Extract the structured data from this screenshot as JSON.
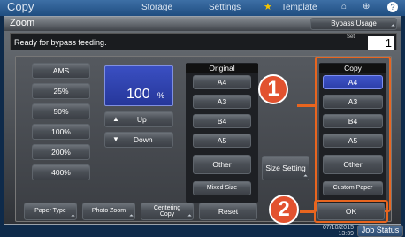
{
  "topbar": {
    "copy": "Copy",
    "storage": "Storage",
    "settings": "Settings",
    "template": "Template",
    "date": "07/10/2015",
    "time": "13:39",
    "job_status": "Job Status"
  },
  "dialog": {
    "title": "Zoom",
    "bypass_usage": "Bypass Usage",
    "status_message": "Ready for bypass feeding.",
    "set_label": "Set",
    "set_value": "1"
  },
  "zoom": {
    "presets": [
      "AMS",
      "25%",
      "50%",
      "100%",
      "200%",
      "400%"
    ],
    "value": "100",
    "unit": "%",
    "up_label": "Up",
    "down_label": "Down"
  },
  "original": {
    "header": "Original",
    "sizes": [
      "A4",
      "A3",
      "B4",
      "A5",
      "Other"
    ],
    "mixed_size": "Mixed Size",
    "size_setting": "Size Setting"
  },
  "copy_paper": {
    "header": "Copy",
    "sizes": [
      "A4",
      "A3",
      "B4",
      "A5",
      "Other"
    ],
    "custom_paper": "Custom Paper"
  },
  "bottom": {
    "paper_type": "Paper Type",
    "photo_zoom": "Photo Zoom",
    "centering_copy": "Centering Copy",
    "reset": "Reset",
    "ok": "OK"
  },
  "callouts": [
    "1",
    "2"
  ],
  "colors": {
    "callout": "#e2522f",
    "selected": "#3245b8",
    "highlight": "#e8651f"
  }
}
